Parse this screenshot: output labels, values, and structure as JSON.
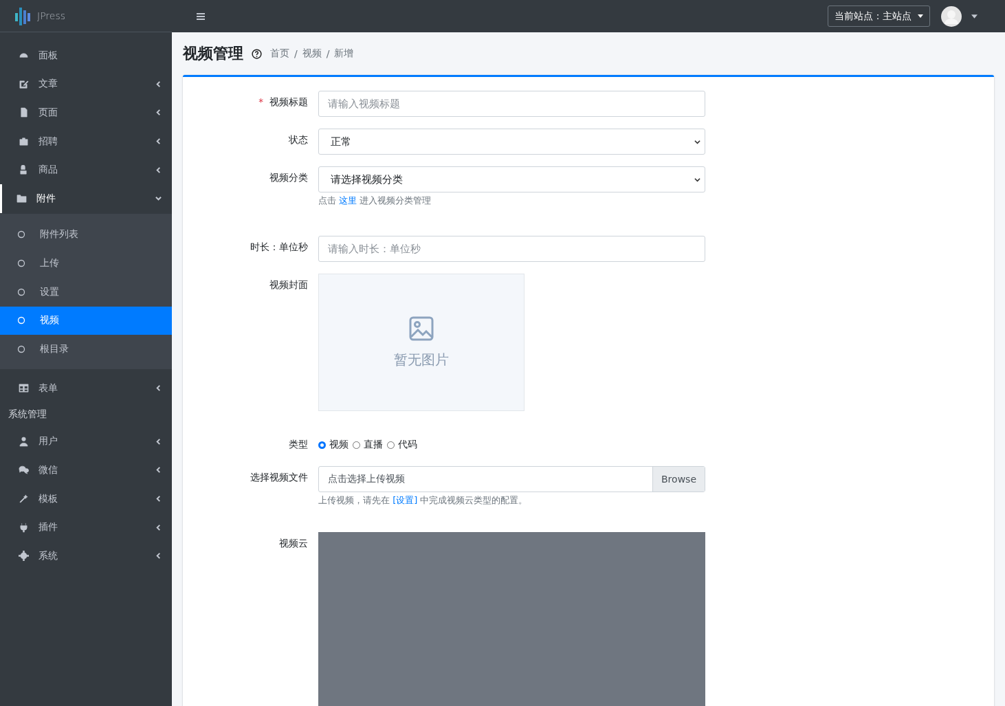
{
  "brand": {
    "name": "JPress"
  },
  "sidebar": {
    "entries": [
      {
        "kind": "item",
        "label": "面板",
        "expandable": false,
        "expanded": false
      },
      {
        "kind": "item",
        "label": "文章",
        "expandable": true,
        "expanded": false
      },
      {
        "kind": "item",
        "label": "页面",
        "expandable": true,
        "expanded": false
      },
      {
        "kind": "item",
        "label": "招聘",
        "expandable": true,
        "expanded": false
      },
      {
        "kind": "item",
        "label": "商品",
        "expandable": true,
        "expanded": false
      },
      {
        "kind": "item",
        "label": "附件",
        "expandable": true,
        "expanded": true,
        "children": [
          {
            "label": "附件列表",
            "selected": false
          },
          {
            "label": "上传",
            "selected": false
          },
          {
            "label": "设置",
            "selected": false
          },
          {
            "label": "视频",
            "selected": true
          },
          {
            "label": "根目录",
            "selected": false
          }
        ]
      },
      {
        "kind": "item",
        "label": "表单",
        "expandable": true,
        "expanded": false
      },
      {
        "kind": "header",
        "label": "系统管理"
      },
      {
        "kind": "item",
        "label": "用户",
        "expandable": true,
        "expanded": false
      },
      {
        "kind": "item",
        "label": "微信",
        "expandable": true,
        "expanded": false
      },
      {
        "kind": "item",
        "label": "模板",
        "expandable": true,
        "expanded": false
      },
      {
        "kind": "item",
        "label": "插件",
        "expandable": true,
        "expanded": false
      },
      {
        "kind": "item",
        "label": "系统",
        "expandable": true,
        "expanded": false
      }
    ]
  },
  "topbar": {
    "site_selector": "当前站点：主站点"
  },
  "page": {
    "title": "视频管理",
    "breadcrumb": {
      "items": [
        "首页",
        "视频",
        "新增"
      ],
      "separator": "/"
    }
  },
  "form": {
    "fields": [
      {
        "kind": "text",
        "label": "视频标题",
        "required_mark": "*",
        "placeholder": "请输入视频标题"
      },
      {
        "kind": "select",
        "label": "状态",
        "value": "正常"
      },
      {
        "kind": "select",
        "label": "视频分类",
        "value": "请选择视频分类",
        "help": {
          "before": "点击",
          "link": "这里",
          "after": "进入视频分类管理"
        }
      },
      {
        "kind": "text",
        "label": "时长：单位秒",
        "placeholder": "请输入时长：单位秒"
      },
      {
        "kind": "image",
        "label": "视频封面",
        "empty_text": "暂无图片"
      },
      {
        "kind": "radio",
        "label": "类型",
        "options": [
          {
            "label": "视频",
            "selected": true
          },
          {
            "label": "直播",
            "selected": false
          },
          {
            "label": "代码",
            "selected": false
          }
        ]
      },
      {
        "kind": "file",
        "label": "选择视频文件",
        "placeholder": "点击选择上传视频",
        "button": "Browse",
        "help": {
          "before": "上传视频，请先在",
          "link": "[设置]",
          "after": "中完成视频云类型的配置。"
        }
      },
      {
        "kind": "video",
        "label": "视频云"
      }
    ]
  }
}
